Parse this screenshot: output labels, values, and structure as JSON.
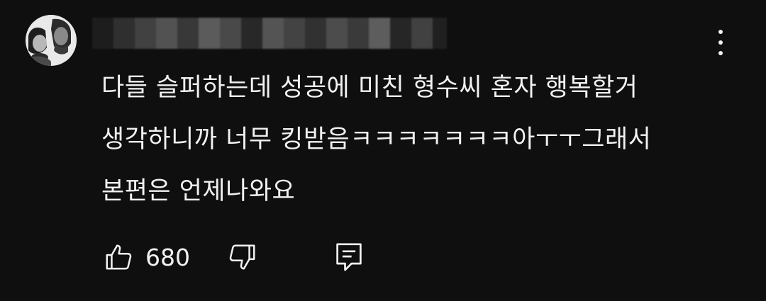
{
  "author": {
    "name": "",
    "avatar_icon": "avatar-icon"
  },
  "comment": {
    "lines": [
      "다들 슬퍼하는데 성공에 미친 형수씨 혼자 행복할거",
      "생각하니까 너무 킹받음ㅋㅋㅋㅋㅋㅋㅋ아ㅜㅜ그래서",
      "본편은 언제나와요"
    ]
  },
  "actions": {
    "like_icon": "thumbs-up-icon",
    "like_count": "680",
    "dislike_icon": "thumbs-down-icon",
    "reply_icon": "reply-comment-icon"
  },
  "menu": {
    "icon": "more-vert-icon"
  },
  "colors": {
    "background": "#0f0f0f",
    "text": "#f1f1f1"
  }
}
